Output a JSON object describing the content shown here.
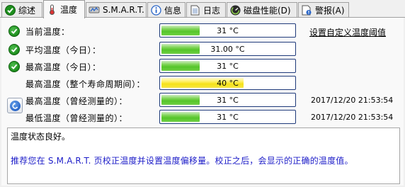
{
  "tabs": [
    {
      "label": "综述",
      "icon": "check-shield-icon"
    },
    {
      "label": "温度",
      "icon": "thermometer-icon",
      "active": true
    },
    {
      "label": "S.M.A.R.T.",
      "icon": "hdd-smart-icon"
    },
    {
      "label": "信息",
      "icon": "info-icon"
    },
    {
      "label": "日志",
      "icon": "document-icon"
    },
    {
      "label": "磁盘性能(D)",
      "icon": "gauge-icon"
    },
    {
      "label": "警报(A)",
      "icon": "alert-document-icon"
    }
  ],
  "custom_threshold_link": "设置自定义温度阈值",
  "rows": [
    {
      "label": "当前温度：",
      "value": "31 °C",
      "level": 0.29,
      "color": "#55c52a",
      "status": "ok"
    },
    {
      "label": "平均温度（今日）：",
      "value": "31.00 °C",
      "level": 0.29,
      "color": "#55c52a",
      "status": "ok"
    },
    {
      "label": "最高温度（今日）：",
      "value": "31 °C",
      "level": 0.29,
      "color": "#55c52a",
      "status": "ok"
    },
    {
      "label": "最高温度（整个寿命周期间）：",
      "value": "40 °C",
      "level": 0.62,
      "color": "#f5e21a"
    },
    {
      "label": "最高温度（曾经测量的）：",
      "value": "31 °C",
      "level": 0.29,
      "color": "#55c52a",
      "timestamp": "2017/12/20 21:53:54"
    },
    {
      "label": "最低温度（曾经测量的）：",
      "value": "31 °C",
      "level": 0.29,
      "color": "#55c52a",
      "timestamp": "2017/12/20 21:53:54"
    }
  ],
  "message": {
    "line1": "温度状态良好。",
    "line2": "推荐您在 S.M.A.R.T. 页校正温度并设置温度偏移量。校正之后，会显示的正确的温度值。"
  }
}
